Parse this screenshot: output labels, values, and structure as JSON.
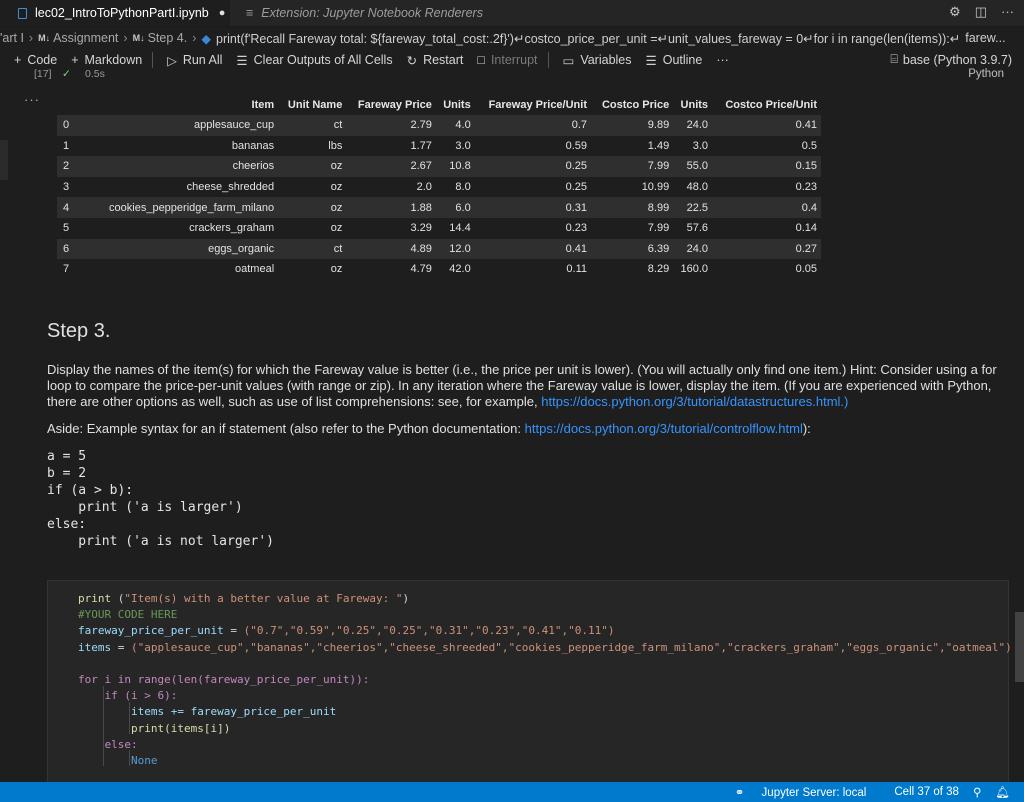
{
  "tabs": [
    {
      "label": "lec02_IntroToPythonPartI.ipynb",
      "modified_marker": "●",
      "active": true
    },
    {
      "label": "Extension: Jupyter Notebook Renderers",
      "active": false
    }
  ],
  "breadcrumb": {
    "items": [
      "'art I",
      "Assignment",
      "Step 4."
    ],
    "md_marker": "M↓",
    "code_preview": "print(f'Recall Fareway total: ${fareway_total_cost:.2f}')↵costco_price_per_unit =↵unit_values_fareway = 0↵for i in range(len(items)):↵",
    "code_tail": "farew..."
  },
  "toolbar": {
    "code": "Code",
    "markdown": "Markdown",
    "run_all": "Run All",
    "clear_outputs": "Clear Outputs of All Cells",
    "restart": "Restart",
    "interrupt": "Interrupt",
    "variables": "Variables",
    "outline": "Outline",
    "more": "···",
    "kernel": "base (Python 3.9.7)"
  },
  "cell_status": {
    "exec_count": "[17]",
    "time": "0.5s",
    "language": "Python"
  },
  "output_menu": "···",
  "table": {
    "headers": [
      "",
      "Item",
      "Unit Name",
      "Fareway Price",
      "Units",
      "Fareway Price/Unit",
      "Costco Price",
      "Units",
      "Costco Price/Unit"
    ],
    "rows": [
      [
        "0",
        "applesauce_cup",
        "ct",
        "2.79",
        "4.0",
        "0.7",
        "9.89",
        "24.0",
        "0.41"
      ],
      [
        "1",
        "bananas",
        "lbs",
        "1.77",
        "3.0",
        "0.59",
        "1.49",
        "3.0",
        "0.5"
      ],
      [
        "2",
        "cheerios",
        "oz",
        "2.67",
        "10.8",
        "0.25",
        "7.99",
        "55.0",
        "0.15"
      ],
      [
        "3",
        "cheese_shredded",
        "oz",
        "2.0",
        "8.0",
        "0.25",
        "10.99",
        "48.0",
        "0.23"
      ],
      [
        "4",
        "cookies_pepperidge_farm_milano",
        "oz",
        "1.88",
        "6.0",
        "0.31",
        "8.99",
        "22.5",
        "0.4"
      ],
      [
        "5",
        "crackers_graham",
        "oz",
        "3.29",
        "14.4",
        "0.23",
        "7.99",
        "57.6",
        "0.14"
      ],
      [
        "6",
        "eggs_organic",
        "ct",
        "4.89",
        "12.0",
        "0.41",
        "6.39",
        "24.0",
        "0.27"
      ],
      [
        "7",
        "oatmeal",
        "oz",
        "4.79",
        "42.0",
        "0.11",
        "8.29",
        "160.0",
        "0.05"
      ]
    ]
  },
  "markdown": {
    "step_title": "Step 3.",
    "paragraph": "Display the names of the item(s) for which the Fareway value is better (i.e., the price per unit is lower). (You will actually only find one item.) Hint: Consider using a for loop to compare the price-per-unit values (with range or zip). In any iteration where the Fareway value is lower, display the item. (If you are experienced with Python, there are other options as well, such as use of list comprehensions: see, for example, ",
    "paragraph_link": "https://docs.python.org/3/tutorial/datastructures.html.)",
    "aside_text": "Aside: Example syntax for an if statement (also refer to the Python documentation: ",
    "aside_link": "https://docs.python.org/3/tutorial/controlflow.html",
    "aside_end": "):",
    "example_code": "a = 5\nb = 2\nif (a > b):\n    print ('a is larger')\nelse:\n    print ('a is not larger')"
  },
  "code_cell": {
    "line1_fn": "print",
    "line1_str": "\"Item(s) with a better value at Fareway: \"",
    "comment": "#YOUR CODE HERE",
    "var_prices": "fareway_price_per_unit",
    "prices_tuple": "(\"0.7\",\"0.59\",\"0.25\",\"0.25\",\"0.31\",\"0.23\",\"0.41\",\"0.11\")",
    "var_items": "items",
    "items_tuple": "(\"applesauce_cup\",\"bananas\",\"cheerios\",\"cheese_shreeded\",\"cookies_pepperidge_farm_milano\",\"crackers_graham\",\"eggs_organic\",\"oatmeal\")",
    "loop": "for i in range(len(fareway_price_per_unit)):",
    "if_line": "if (i > 6):",
    "assign_line": "items += fareway_price_per_unit",
    "print_line": "print(items[i])",
    "else_line": "else:",
    "none_line": "None"
  },
  "statusbar": {
    "jupyter": "Jupyter Server: local",
    "cell": "Cell 37 of 38"
  }
}
